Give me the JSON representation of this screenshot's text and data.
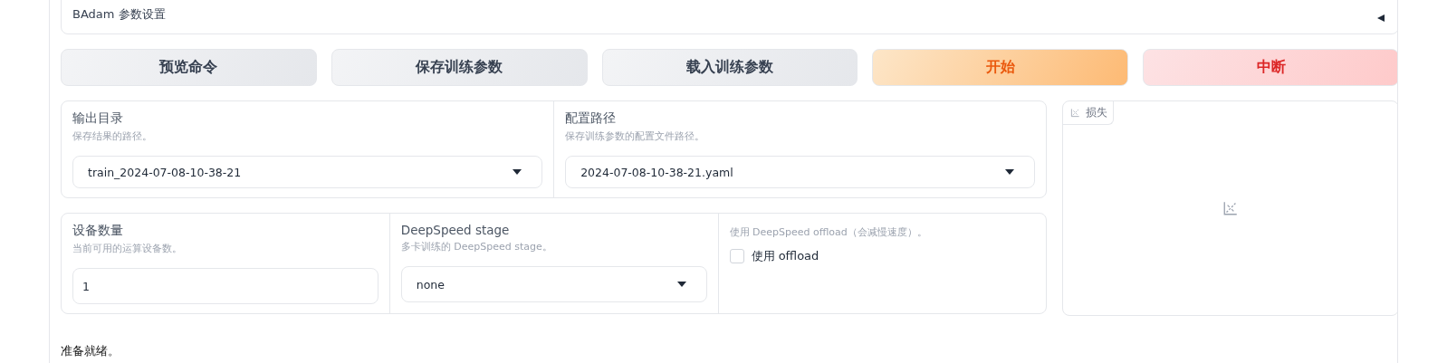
{
  "accordion": {
    "title": "BAdam 参数设置",
    "expanded": false
  },
  "buttons": [
    {
      "label": "预览命令",
      "kind": "secondary"
    },
    {
      "label": "保存训练参数",
      "kind": "secondary"
    },
    {
      "label": "载入训练参数",
      "kind": "secondary"
    },
    {
      "label": "开始",
      "kind": "primary"
    },
    {
      "label": "中断",
      "kind": "stop"
    }
  ],
  "path_row": [
    {
      "kind": "dropdown",
      "label": "输出目录",
      "info": "保存结果的路径。",
      "value": "train_2024-07-08-10-38-21"
    },
    {
      "kind": "dropdown",
      "label": "配置路径",
      "info": "保存训练参数的配置文件路径。",
      "value": "2024-07-08-10-38-21.yaml"
    }
  ],
  "device_row": [
    {
      "kind": "textbox",
      "label": "设备数量",
      "info": "当前可用的运算设备数。",
      "value": "1"
    },
    {
      "kind": "dropdown",
      "label": "DeepSpeed stage",
      "info": "多卡训练的 DeepSpeed stage。",
      "value": "none"
    },
    {
      "kind": "checkbox",
      "info": "使用 DeepSpeed offload（会减慢速度）。",
      "label": "使用 offload",
      "checked": false
    }
  ],
  "plot": {
    "label": "损失"
  },
  "status": "准备就绪。"
}
